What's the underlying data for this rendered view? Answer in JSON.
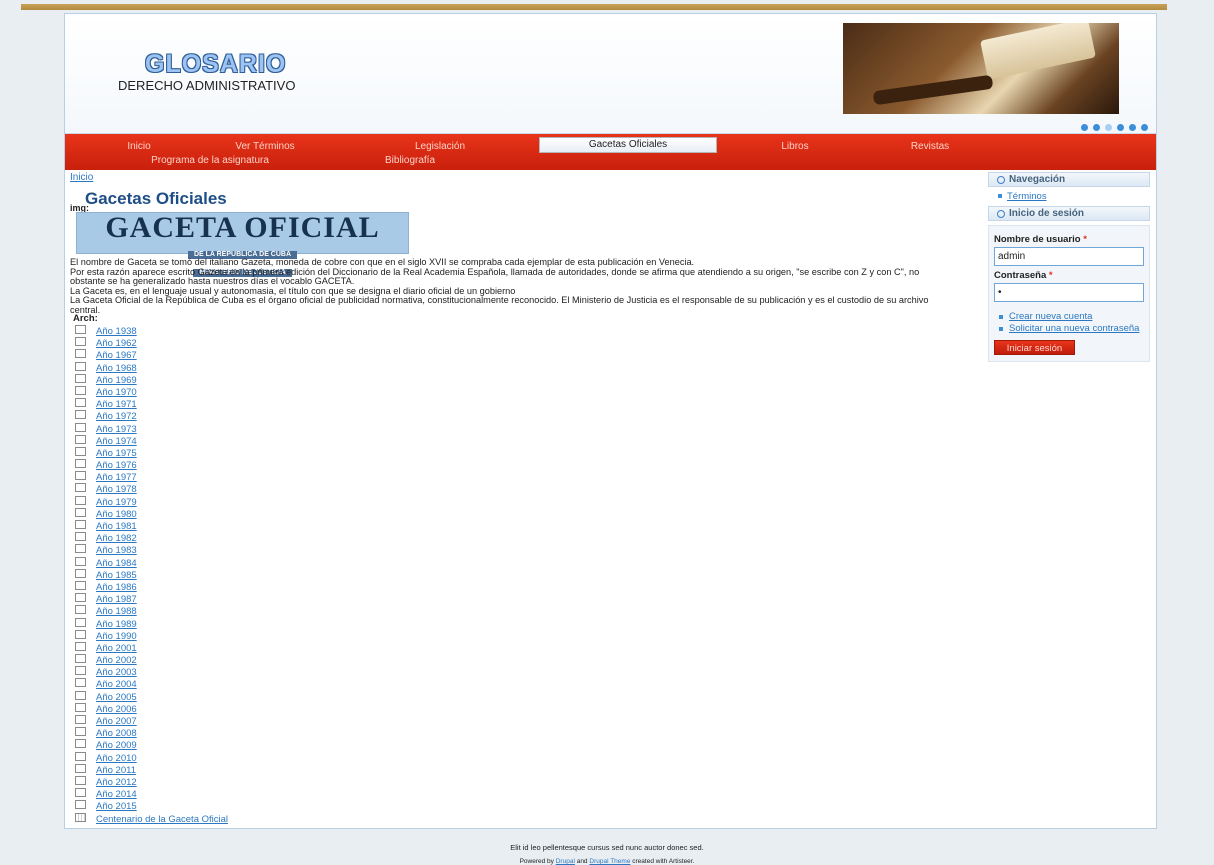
{
  "header": {
    "title": "GLOSARIO",
    "subtitle": "DERECHO ADMINISTRATIVO",
    "slider_dots": 6
  },
  "nav": {
    "items": [
      {
        "label": "Inicio"
      },
      {
        "label": "Ver Términos"
      },
      {
        "label": "Legislación"
      },
      {
        "label": "Gacetas Oficiales"
      },
      {
        "label": "Libros"
      },
      {
        "label": "Revistas"
      },
      {
        "label": "Programa de la asignatura"
      },
      {
        "label": "Bibliografía"
      }
    ],
    "active": "Gacetas Oficiales"
  },
  "breadcrumb": "Inicio",
  "page_title": "Gacetas Oficiales",
  "img_label": "img:",
  "gaceta_logo": {
    "line1": "GACETA OFICIAL",
    "line2": "DE LA REPUBLICA DE CUBA",
    "line3": "MINISTERIO DE JUSTICIA"
  },
  "body_text": [
    "El nombre de Gaceta se tomó del italiano Gazeta, moneda de cobre con que en el siglo XVII se compraba cada ejemplar de esta publicación en Venecia.",
    "Por esta razón aparece escrito Gazeta en la primera edición del Diccionario de la Real Academia Española, llamada de autoridades, donde se afirma que atendiendo a su origen, \"se escribe con Z y con C\", no obstante se ha generalizado hasta nuestros días el vocablo GACETA.",
    "La Gaceta es, en el lenguaje usual y autonomasia, el título con que se designa el diario oficial de un gobierno",
    "La Gaceta Oficial de la República de Cuba es el órgano oficial de publicidad normativa, constitucionalmente reconocido. El Ministerio de Justicia es el responsable de su publicación y es el custodio de su archivo central."
  ],
  "arch_label": "Arch:",
  "files": [
    "Año 1938",
    "Año 1962",
    "Año 1967",
    "Año 1968",
    "Año 1969",
    "Año 1970",
    "Año 1971",
    "Año 1972",
    "Año 1973",
    "Año 1974",
    "Año 1975",
    "Año 1976",
    "Año 1977",
    "Año 1978",
    "Año 1979",
    "Año 1980",
    "Año 1981",
    "Año 1982",
    "Año 1983",
    "Año 1984",
    "Año 1985",
    "Año 1986",
    "Año 1987",
    "Año 1988",
    "Año 1989",
    "Año 1990",
    "Año 2001",
    "Año 2002",
    "Año 2003",
    "Año 2004",
    "Año 2005",
    "Año 2006",
    "Año 2007",
    "Año 2008",
    "Año 2009",
    "Año 2010",
    "Año 2011",
    "Año 2012",
    "Año 2014",
    "Año 2015"
  ],
  "book_item": "Centenario de la Gaceta Oficial",
  "sidebar": {
    "nav_title": "Navegación",
    "nav_link": "Términos",
    "login_title": "Inicio de sesión",
    "username_label": "Nombre de usuario",
    "username_value": "admin",
    "password_label": "Contraseña",
    "password_value": "•",
    "required_mark": "*",
    "link_create": "Crear nueva cuenta",
    "link_request": "Solicitar una nueva contraseña",
    "login_button": "Iniciar sesión"
  },
  "footer": {
    "line1": "Elit id leo pellentesque cursus sed nunc auctor donec sed.",
    "powered_by": "Powered by",
    "drupal": "Drupal",
    "and": "and",
    "drupal_theme": "Drupal Theme",
    "created_with": "created with Artisteer."
  },
  "colors": {
    "nav_red": "#d42a12",
    "link_blue": "#2b78c2",
    "title_blue": "#1f4e86"
  }
}
